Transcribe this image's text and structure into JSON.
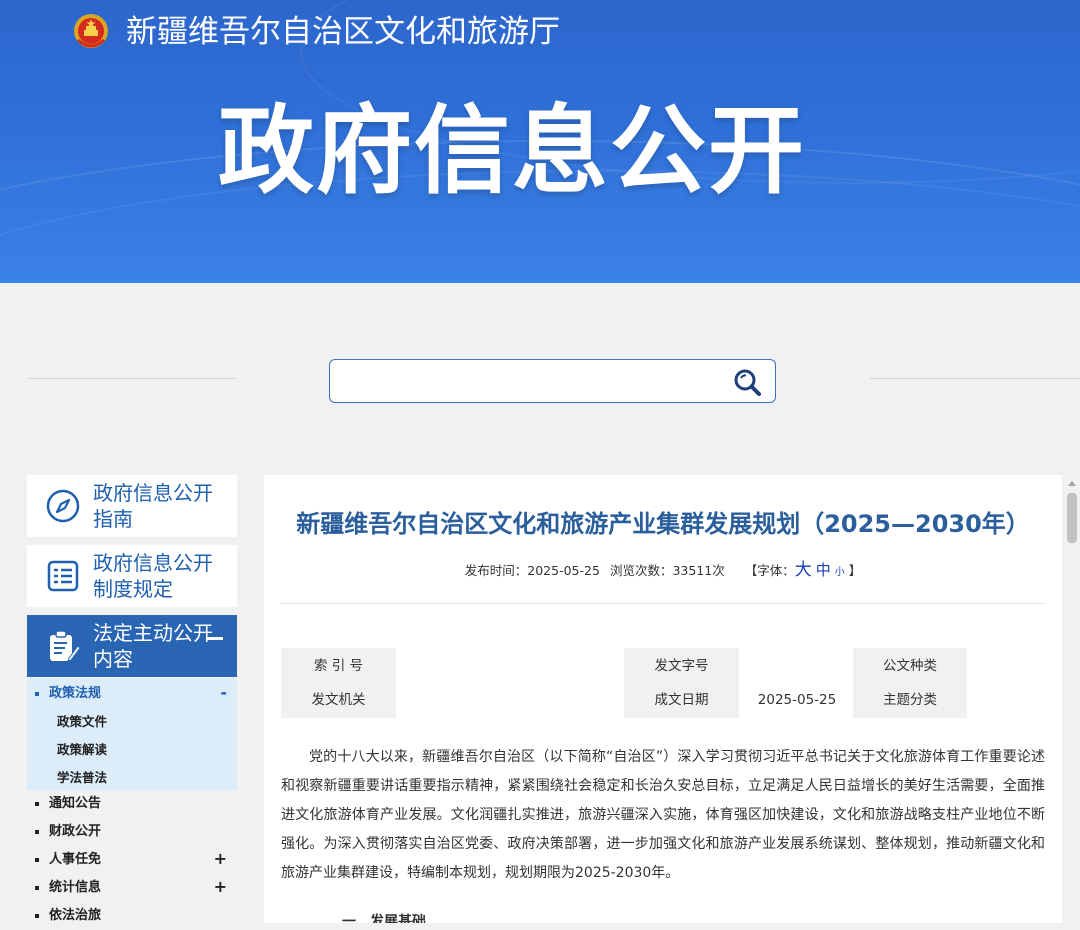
{
  "header": {
    "site_title": "新疆维吾尔自治区文化和旅游厅",
    "banner_heading": "政府信息公开",
    "emblem_icon": "national-emblem-icon"
  },
  "search": {
    "value": "",
    "placeholder": "",
    "button_icon": "search-icon"
  },
  "sidebar": {
    "cards": [
      {
        "label": "政府信息公开指南",
        "icon": "compass-icon"
      },
      {
        "label": "政府信息公开制度规定",
        "icon": "list-document-icon"
      },
      {
        "label": "法定主动公开内容",
        "icon": "clipboard-edit-icon",
        "toggle": "−"
      }
    ],
    "nav": {
      "current": {
        "label": "政策法规",
        "toggle": "-"
      },
      "sub_items": [
        "政策文件",
        "政策解读",
        "学法普法"
      ],
      "items": [
        {
          "label": "通知公告",
          "toggle": ""
        },
        {
          "label": "财政公开",
          "toggle": ""
        },
        {
          "label": "人事任免",
          "toggle": "+"
        },
        {
          "label": "统计信息",
          "toggle": "+"
        },
        {
          "label": "依法治旅",
          "toggle": ""
        }
      ]
    }
  },
  "article": {
    "title": "新疆维吾尔自治区文化和旅游产业集群发展规划（2025—2030年）",
    "publish_label": "发布时间：",
    "publish_date": "2025-05-25",
    "views_label": "浏览次数：",
    "views": "33511次",
    "font_label": "【字体：",
    "font_big": "大",
    "font_mid": "中",
    "font_small": "小",
    "font_close": "】",
    "meta_table": {
      "index_no_label": "索 引 号",
      "issuer_label": "发文机关",
      "doc_no_label": "发文字号",
      "date_label": "成文日期",
      "date_value": "2025-05-25",
      "doc_type_label": "公文种类",
      "topic_label": "主题分类"
    },
    "body": "党的十八大以来，新疆维吾尔自治区（以下简称“自治区”）深入学习贯彻习近平总书记关于文化旅游体育工作重要论述和视察新疆重要讲话重要指示精神，紧紧围绕社会稳定和长治久安总目标，立足满足人民日益增长的美好生活需要，全面推进文化旅游体育产业发展。文化润疆扎实推进，旅游兴疆深入实施，体育强区加快建设，文化和旅游战略支柱产业地位不断强化。为深入贯彻落实自治区党委、政府决策部署，进一步加强文化和旅游产业发展系统谋划、整体规划，推动新疆文化和旅游产业集群建设，特编制本规划，规划期限为2025-2030年。",
    "section_head": "一、发展基础"
  },
  "colors": {
    "banner": "#2f70d8",
    "accent": "#2a65b4",
    "title": "#2a5e9c",
    "sub_panel": "#dcecf8"
  }
}
